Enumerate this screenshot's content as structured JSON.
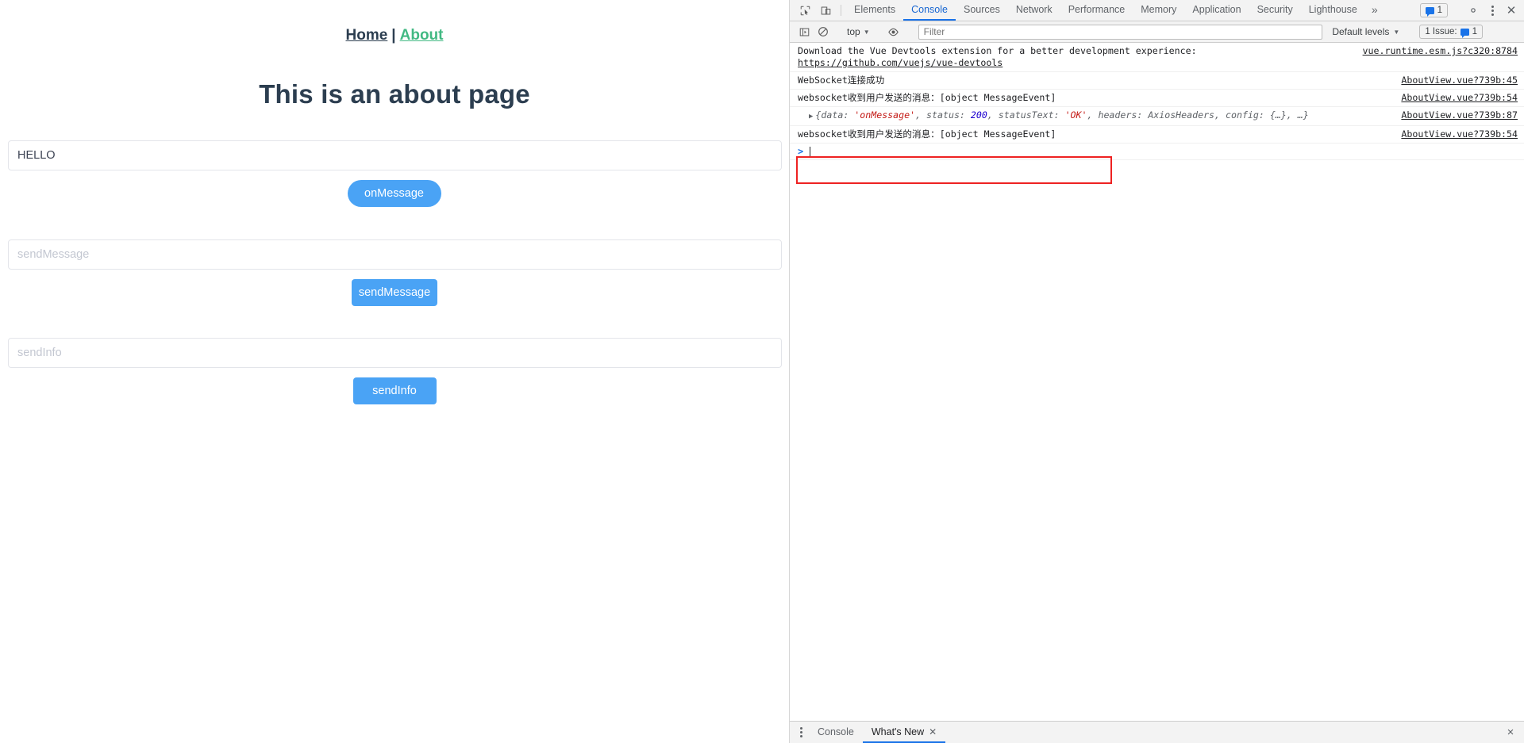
{
  "page": {
    "nav": {
      "home": "Home",
      "separator": "|",
      "about": "About",
      "active_color": "#42b983"
    },
    "heading": "This is an about page",
    "fields": [
      {
        "name": "message-input",
        "value": "HELLO",
        "placeholder": ""
      },
      {
        "name": "send-message-input",
        "value": "",
        "placeholder": "sendMessage"
      },
      {
        "name": "send-info-input",
        "value": "",
        "placeholder": "sendInfo"
      }
    ],
    "buttons": [
      {
        "name": "on-message-button",
        "label": "onMessage",
        "shape": "pill"
      },
      {
        "name": "send-message-button",
        "label": "sendMessage",
        "shape": "rect"
      },
      {
        "name": "send-info-button",
        "label": "sendInfo",
        "shape": "rect"
      }
    ],
    "button_color": "#4aa3f5"
  },
  "devtools": {
    "tabs": [
      {
        "label": "Elements",
        "selected": false
      },
      {
        "label": "Console",
        "selected": true
      },
      {
        "label": "Sources",
        "selected": false
      },
      {
        "label": "Network",
        "selected": false
      },
      {
        "label": "Performance",
        "selected": false
      },
      {
        "label": "Memory",
        "selected": false
      },
      {
        "label": "Application",
        "selected": false
      },
      {
        "label": "Security",
        "selected": false
      },
      {
        "label": "Lighthouse",
        "selected": false
      }
    ],
    "more_tabs": "»",
    "message_count": "1",
    "toolbar": {
      "context": "top",
      "filter_placeholder": "Filter",
      "levels": "Default levels",
      "issues_label": "1 Issue:",
      "issues_count": "1"
    },
    "console": {
      "entries": [
        {
          "type": "text",
          "text": "Download the Vue Devtools extension for a better development experience:",
          "link_text": "https://github.com/vuejs/vue-devtools",
          "source": "vue.runtime.esm.js?c320:8784"
        },
        {
          "type": "text",
          "text": "WebSocket连接成功",
          "source": "AboutView.vue?739b:45"
        },
        {
          "type": "text",
          "text": "websocket收到用户发送的消息：[object MessageEvent]",
          "source": "AboutView.vue?739b:54"
        },
        {
          "type": "object",
          "tokens": [
            {
              "t": "{data: ",
              "c": "key"
            },
            {
              "t": "'onMessage'",
              "c": "str"
            },
            {
              "t": ", status: ",
              "c": "key"
            },
            {
              "t": "200",
              "c": "num"
            },
            {
              "t": ", statusText: ",
              "c": "key"
            },
            {
              "t": "'OK'",
              "c": "str"
            },
            {
              "t": ", headers: ",
              "c": "key"
            },
            {
              "t": "AxiosHeaders",
              "c": "cls"
            },
            {
              "t": ", config: {…}, …}",
              "c": "key"
            }
          ],
          "source": "AboutView.vue?739b:87"
        },
        {
          "type": "text",
          "text": "websocket收到用户发送的消息：[object MessageEvent]",
          "source": "AboutView.vue?739b:54",
          "highlighted": true
        }
      ],
      "prompt_symbol": ">",
      "prompt_value": ""
    },
    "drawer": {
      "tabs": [
        {
          "label": "Console",
          "selected": false,
          "closable": false
        },
        {
          "label": "What's New",
          "selected": true,
          "closable": true
        }
      ],
      "close_label": "×"
    }
  }
}
